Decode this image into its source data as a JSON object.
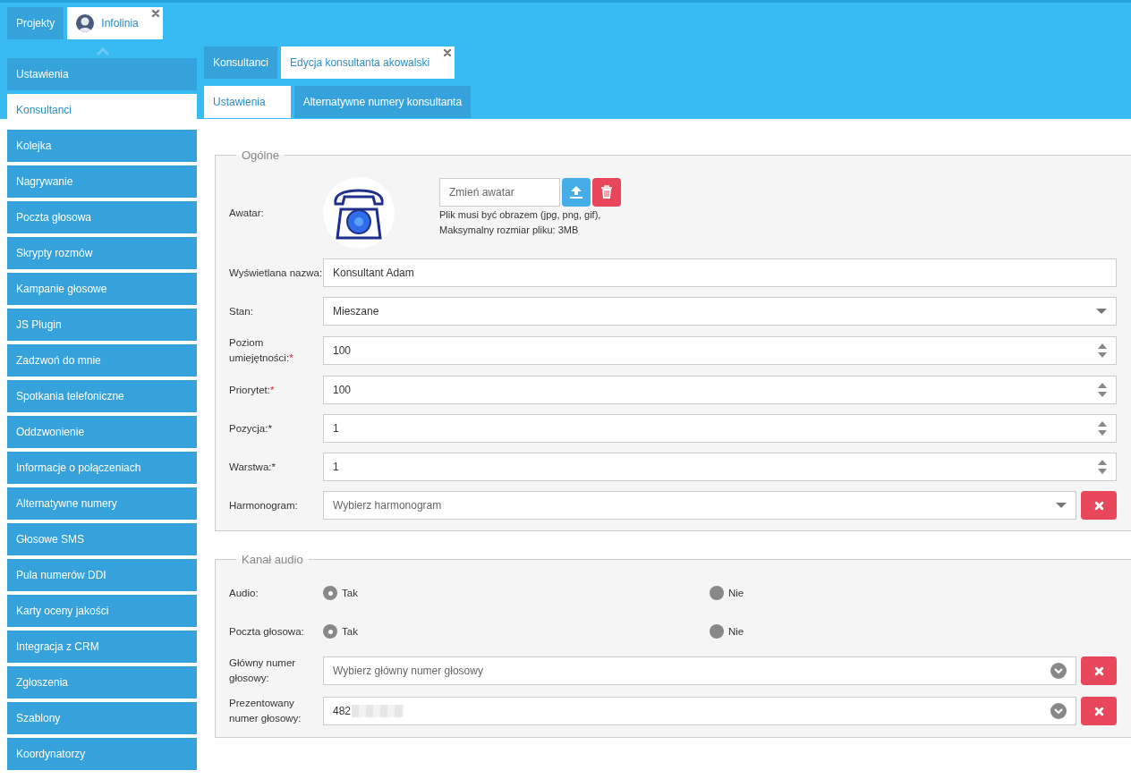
{
  "project_tabs": [
    {
      "label": "Projekty",
      "selected": false,
      "closable": false,
      "avatar": false
    },
    {
      "label": "Infolinia",
      "selected": true,
      "closable": true,
      "avatar": true
    }
  ],
  "sidebar": {
    "items": [
      {
        "label": "Ustawienia",
        "selected": false
      },
      {
        "label": "Konsultanci",
        "selected": true
      },
      {
        "label": "Kolejka",
        "selected": false
      },
      {
        "label": "Nagrywanie",
        "selected": false
      },
      {
        "label": "Poczta głosowa",
        "selected": false
      },
      {
        "label": "Skrypty rozmów",
        "selected": false
      },
      {
        "label": "Kampanie głosowe",
        "selected": false
      },
      {
        "label": "JS Plugin",
        "selected": false
      },
      {
        "label": "Zadzwoń do mnie",
        "selected": false
      },
      {
        "label": "Spotkania telefoniczne",
        "selected": false
      },
      {
        "label": "Oddzwonienie",
        "selected": false
      },
      {
        "label": "Informacje o połączeniach",
        "selected": false
      },
      {
        "label": "Alternatywne numery",
        "selected": false
      },
      {
        "label": "Głosowe SMS",
        "selected": false
      },
      {
        "label": "Pula numerów DDI",
        "selected": false
      },
      {
        "label": "Karty oceny jakości",
        "selected": false
      },
      {
        "label": "Integracja z CRM",
        "selected": false
      },
      {
        "label": "Zgłoszenia",
        "selected": false
      },
      {
        "label": "Szablony",
        "selected": false
      },
      {
        "label": "Koordynatorzy",
        "selected": false
      }
    ]
  },
  "page_tabs": [
    {
      "label": "Konsultanci",
      "selected": false,
      "closable": false
    },
    {
      "label": "Edycja konsultanta akowalski",
      "selected": true,
      "closable": true
    }
  ],
  "sub_tabs": [
    {
      "label": "Ustawienia",
      "selected": true
    },
    {
      "label": "Alternatywne numery konsultanta",
      "selected": false
    }
  ],
  "general": {
    "legend": "Ogólne",
    "avatar": {
      "label": "Awatar:",
      "file_placeholder": "Zmień awatar",
      "hint_1": "Plik musi być obrazem (jpg, png, gif),",
      "hint_2": "Maksymalny rozmiar pliku: 3MB"
    },
    "fields": [
      {
        "kind": "text",
        "label": "Wyświetlana nazwa:",
        "value": "Konsultant Adam"
      },
      {
        "kind": "select",
        "label": "Stan:",
        "value": "Mieszane"
      },
      {
        "kind": "number",
        "label": "Poziom umiejętności:",
        "required_mark": "*",
        "value": "100"
      },
      {
        "kind": "number",
        "label": "Priorytet:",
        "required_mark": "*",
        "value": "100"
      },
      {
        "kind": "number",
        "label": "Pozycja:*",
        "value": "1"
      },
      {
        "kind": "number",
        "label": "Warstwa:*",
        "value": "1"
      },
      {
        "kind": "select-clear",
        "label": "Harmonogram:",
        "placeholder": "Wybierz harmonogram"
      }
    ]
  },
  "audio": {
    "legend": "Kanał audio",
    "radios": [
      {
        "label": "Audio:",
        "options": [
          {
            "label": "Tak",
            "selected": true
          },
          {
            "label": "Nie",
            "selected": false
          }
        ]
      },
      {
        "label": "Poczta głosowa:",
        "options": [
          {
            "label": "Tak",
            "selected": true
          },
          {
            "label": "Nie",
            "selected": false
          }
        ]
      }
    ],
    "fields": [
      {
        "kind": "combo-clear",
        "label": "Główny numer głosowy:",
        "placeholder": "Wybierz główny numer głosowy",
        "redacted": false
      },
      {
        "kind": "combo-clear",
        "label": "Prezentowany numer głosowy:",
        "value": "482",
        "redacted": true
      }
    ]
  }
}
